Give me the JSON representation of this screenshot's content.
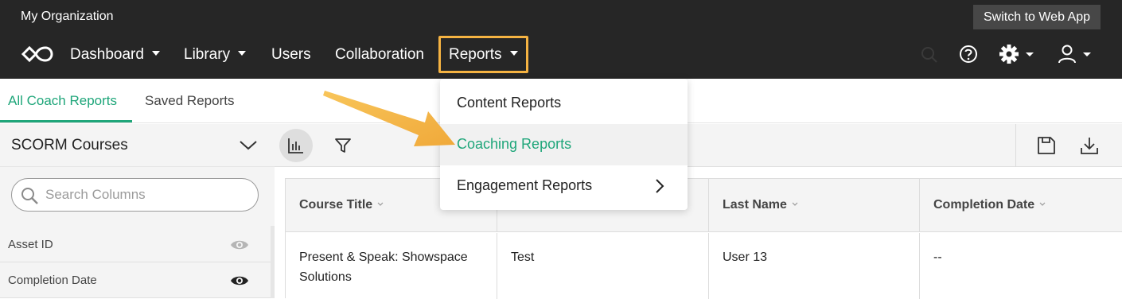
{
  "header": {
    "org_name": "My Organization",
    "switch_label": "Switch to Web App",
    "nav": [
      {
        "label": "Dashboard"
      },
      {
        "label": "Library"
      },
      {
        "label": "Users"
      },
      {
        "label": "Collaboration"
      },
      {
        "label": "Reports"
      }
    ]
  },
  "tabs": [
    {
      "label": "All Coach Reports"
    },
    {
      "label": "Saved Reports"
    }
  ],
  "left_panel": {
    "title": "SCORM Courses",
    "search_placeholder": "Search Columns",
    "columns": [
      {
        "label": "Asset ID",
        "visible": false
      },
      {
        "label": "Completion Date",
        "visible": true
      }
    ]
  },
  "grid": {
    "headers": [
      "Course Title",
      "",
      "Last Name",
      "Completion Date"
    ],
    "rows": [
      [
        "Present & Speak: Showspace Solutions",
        "Test",
        "User 13",
        "--"
      ]
    ]
  },
  "reports_menu": [
    {
      "label": "Content Reports"
    },
    {
      "label": "Coaching Reports"
    },
    {
      "label": "Engagement Reports"
    }
  ],
  "colors": {
    "accent": "#1fa67a",
    "highlight_border": "#f5b342",
    "topbar": "#262626"
  }
}
